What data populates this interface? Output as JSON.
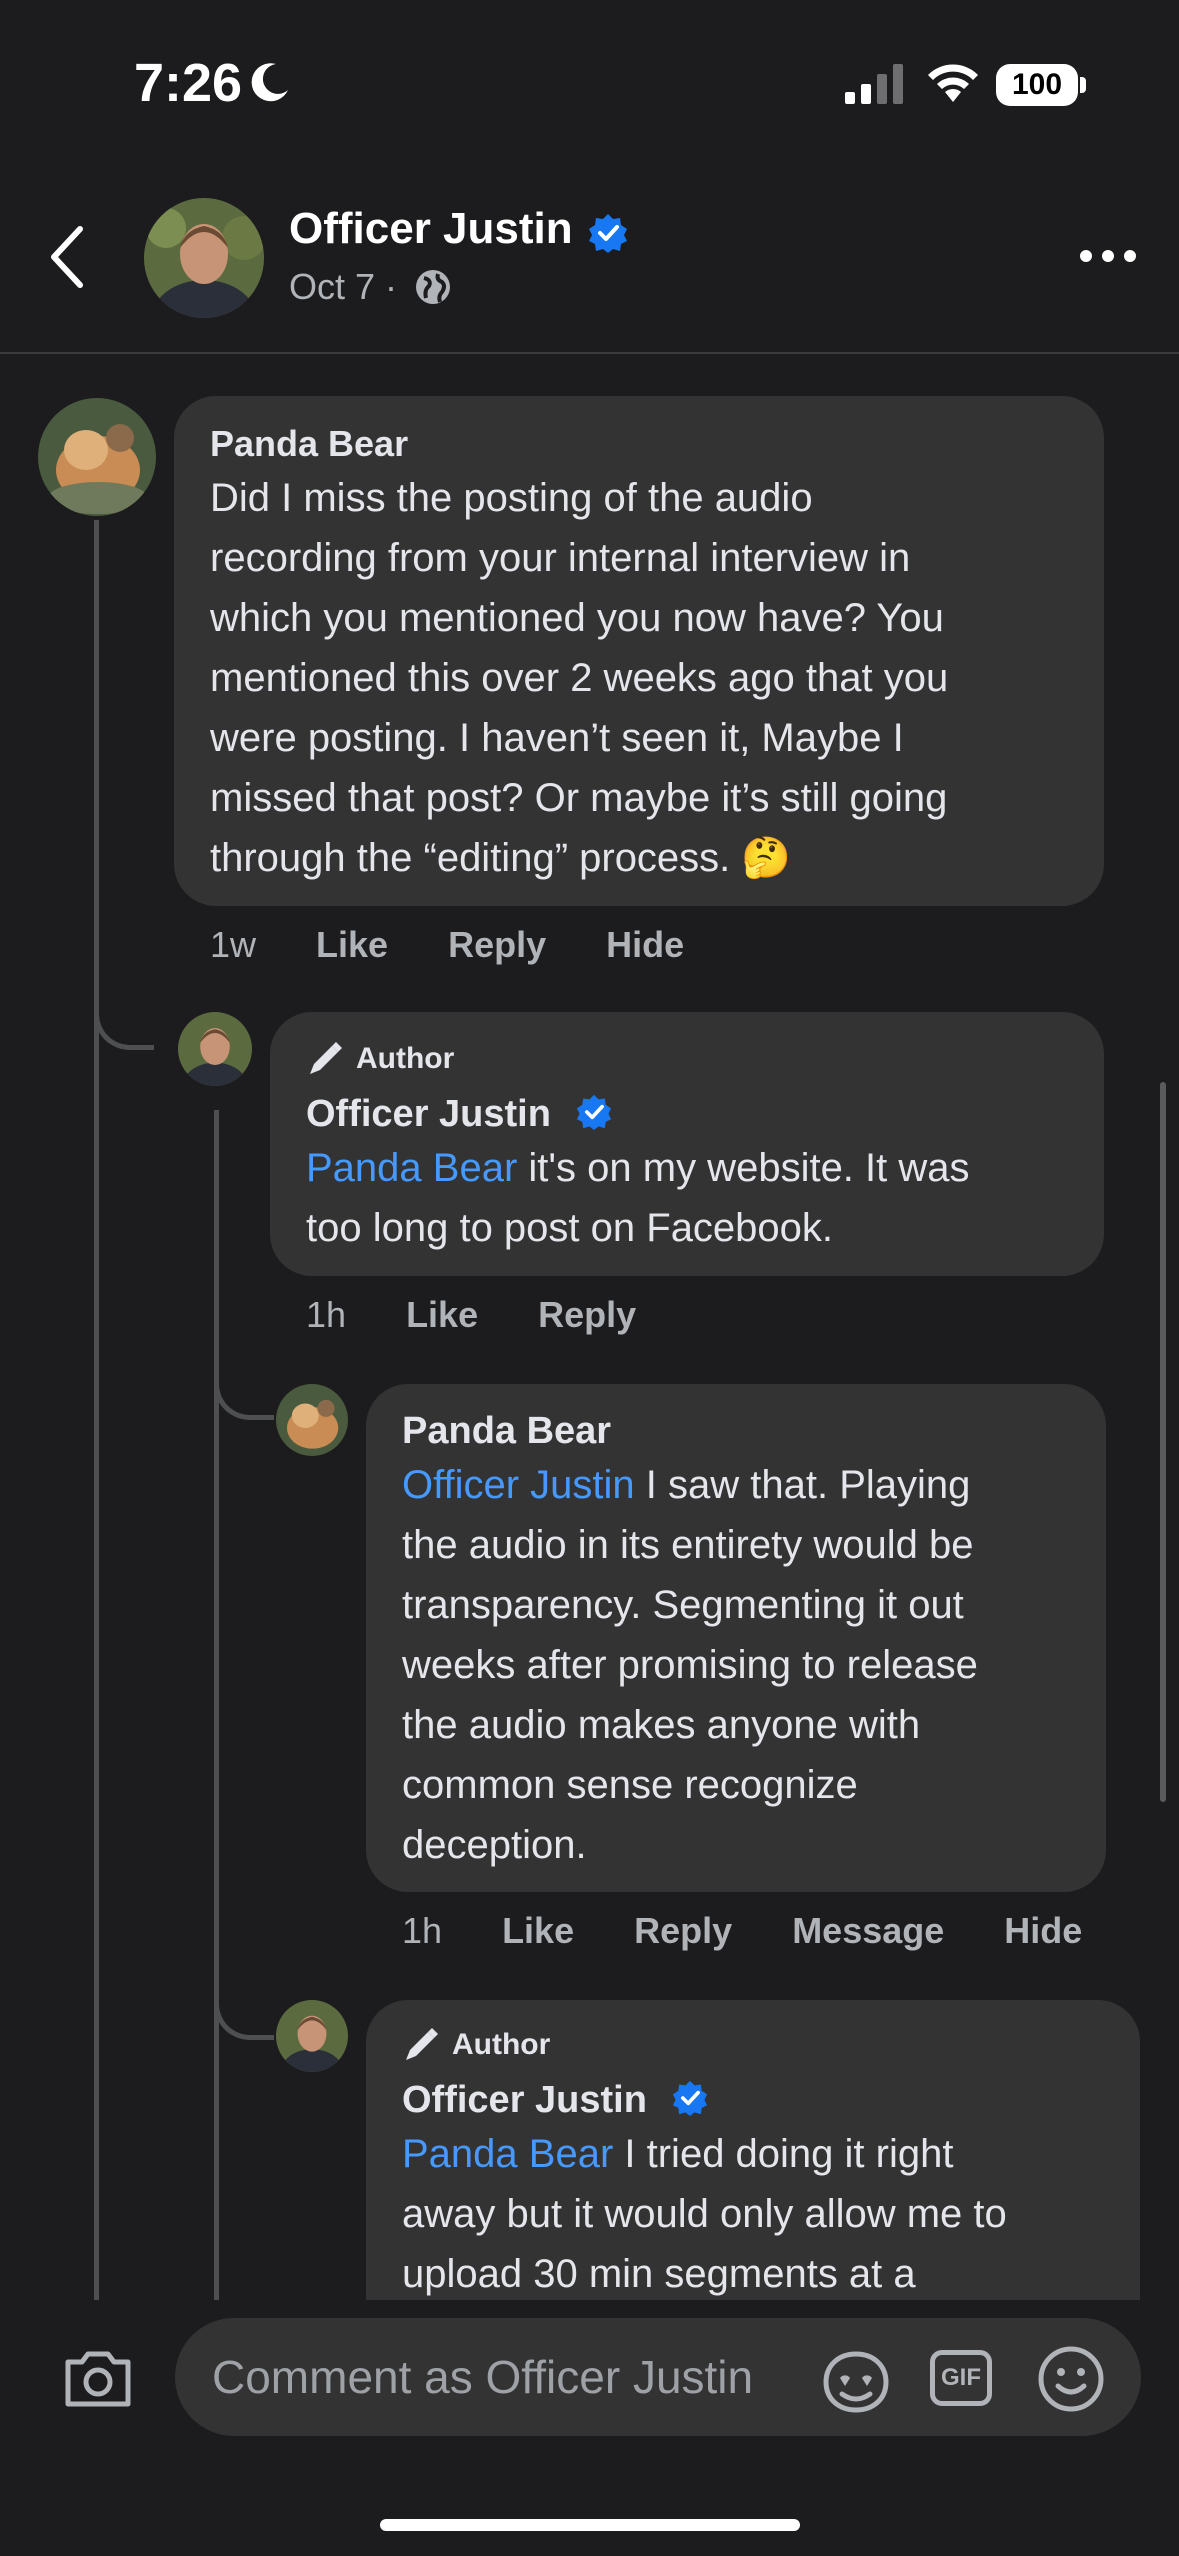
{
  "status_bar": {
    "time": "7:26",
    "battery": "100"
  },
  "header": {
    "name": "Officer Justin",
    "date": "Oct 7 ·"
  },
  "comments": [
    {
      "name": "Panda Bear",
      "lines": [
        "Did I miss the posting of the audio",
        "recording from your internal interview in",
        "which you mentioned you now have? You",
        "mentioned this over 2 weeks ago that you",
        "were posting. I haven’t seen it, Maybe I",
        "missed that post? Or maybe it’s still going",
        "through the “editing” process. 🤔"
      ],
      "time": "1w",
      "actions": [
        "Like",
        "Reply",
        "Hide"
      ]
    },
    {
      "author_label": "Author",
      "name": "Officer Justin",
      "mention": "Panda Bear",
      "line1_rest": " it's on my website. It was",
      "line2": "too long to post on Facebook.",
      "time": "1h",
      "actions": [
        "Like",
        "Reply"
      ]
    },
    {
      "name": "Panda Bear",
      "mention": "Officer Justin",
      "line1_rest": " I saw that. Playing",
      "lines": [
        "the audio in its entirety would be",
        "transparency.  Segmenting it out",
        "weeks after promising to release",
        "the audio makes anyone with",
        "common sense recognize",
        "deception."
      ],
      "time": "1h",
      "actions": [
        "Like",
        "Reply",
        "Message",
        "Hide"
      ]
    },
    {
      "author_label": "Author",
      "name": "Officer Justin",
      "mention": "Panda Bear",
      "line1_rest": " I tried doing it right",
      "lines": [
        "away but it would only allow me to",
        "upload 30 min segments at a"
      ]
    }
  ],
  "composer": {
    "placeholder": "Comment as Officer Justin",
    "gif_label": "GIF"
  },
  "colors": {
    "mention": "#4599ff",
    "verified": "#1877f2",
    "bubble": "#333334",
    "background": "#1c1c1e"
  },
  "icons": [
    "moon-icon",
    "signal-icon",
    "wifi-icon",
    "back-icon",
    "verified-icon",
    "globe-icon",
    "more-icon",
    "pencil-icon",
    "camera-icon",
    "sticker-icon",
    "emoji-icon"
  ]
}
